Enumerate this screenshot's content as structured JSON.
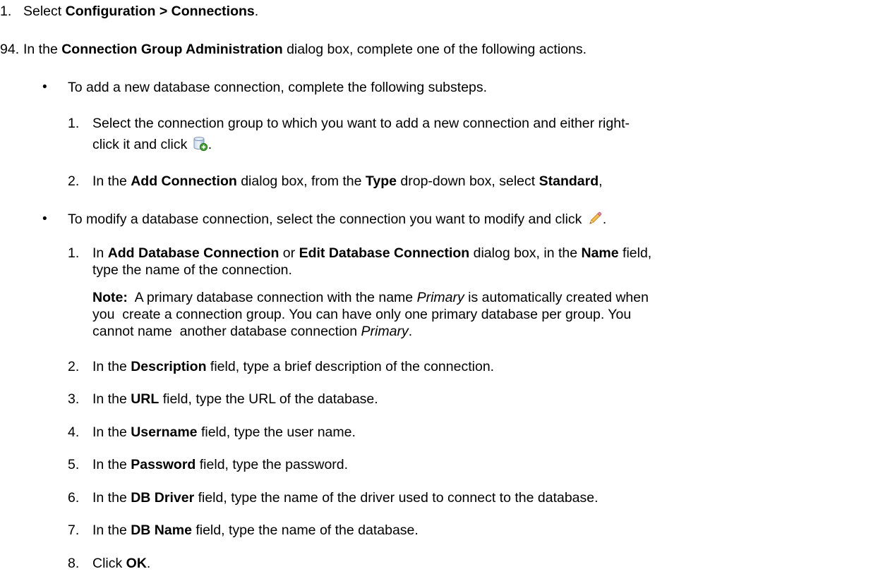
{
  "steps": [
    {
      "number": "1.",
      "parts": [
        {
          "text": "Select ",
          "bold": false
        },
        {
          "text": "Configuration > Connections",
          "bold": true
        },
        {
          "text": ".",
          "bold": false
        }
      ]
    },
    {
      "number": "94.",
      "parts": [
        {
          "text": "In the ",
          "bold": false
        },
        {
          "text": "Connection Group Administration",
          "bold": true
        },
        {
          "text": " dialog box, complete one of the following actions.",
          "bold": false
        }
      ]
    }
  ],
  "bullets": [
    {
      "text": "To add a new database connection, complete the following substeps.",
      "substeps": [
        {
          "number": "1.",
          "line1": "Select the connection group to which you want to add a new connection and either right-",
          "line2": "click it and click",
          "icon": "add-database-icon",
          "after_icon": "."
        },
        {
          "number": "2.",
          "parts": [
            {
              "text": "In the ",
              "bold": false
            },
            {
              "text": "Add Connection",
              "bold": true
            },
            {
              "text": " dialog box, from the ",
              "bold": false
            },
            {
              "text": "Type",
              "bold": true
            },
            {
              "text": " drop-down box, select ",
              "bold": false
            },
            {
              "text": "Standard",
              "bold": true
            },
            {
              "text": ",",
              "bold": false
            }
          ]
        }
      ]
    },
    {
      "text": "To modify a database connection, select the connection you want to modify and click",
      "icon": "edit-pencil-icon",
      "after_icon": ".",
      "substeps": [
        {
          "number": "1.",
          "line1_parts": [
            {
              "text": "In ",
              "bold": false
            },
            {
              "text": "Add Database Connection",
              "bold": true
            },
            {
              "text": " or ",
              "bold": false
            },
            {
              "text": "Edit Database Connection",
              "bold": true
            },
            {
              "text": " dialog box, in the ",
              "bold": false
            },
            {
              "text": "Name",
              "bold": true
            },
            {
              "text": " field,",
              "bold": false
            }
          ],
          "line2": "type the  name of the connection.",
          "note": {
            "label": "Note:",
            "line1_a": "  A primary database connection with the name ",
            "line1_italic": "Primary",
            "line1_b": " is automatically created when",
            "line2": "you  create a connection group. You can have only one primary database per group. You",
            "line3_a": "cannot name  another database connection ",
            "line3_italic": "Primary",
            "line3_b": "."
          }
        },
        {
          "number": "2.",
          "parts": [
            {
              "text": "In the ",
              "bold": false
            },
            {
              "text": "Description",
              "bold": true
            },
            {
              "text": " field, type a brief description of the connection.",
              "bold": false
            }
          ]
        },
        {
          "number": "3.",
          "parts": [
            {
              "text": "In the ",
              "bold": false
            },
            {
              "text": "URL",
              "bold": true
            },
            {
              "text": " field, type the URL of the database.",
              "bold": false
            }
          ]
        },
        {
          "number": "4.",
          "parts": [
            {
              "text": "In the ",
              "bold": false
            },
            {
              "text": "Username",
              "bold": true
            },
            {
              "text": " field, type the user name.",
              "bold": false
            }
          ]
        },
        {
          "number": "5.",
          "parts": [
            {
              "text": "In the ",
              "bold": false
            },
            {
              "text": "Password",
              "bold": true
            },
            {
              "text": " field, type the password.",
              "bold": false
            }
          ]
        },
        {
          "number": "6.",
          "parts": [
            {
              "text": "In the ",
              "bold": false
            },
            {
              "text": "DB Driver",
              "bold": true
            },
            {
              "text": " field, type the name of the driver used to connect to the database.",
              "bold": false
            }
          ]
        },
        {
          "number": "7.",
          "parts": [
            {
              "text": "In the ",
              "bold": false
            },
            {
              "text": "DB Name",
              "bold": true
            },
            {
              "text": " field, type the name of the database.",
              "bold": false
            }
          ]
        },
        {
          "number": "8.",
          "parts": [
            {
              "text": "Click ",
              "bold": false
            },
            {
              "text": "OK",
              "bold": true
            },
            {
              "text": ".",
              "bold": false
            }
          ]
        }
      ]
    }
  ],
  "colors": {
    "text": "#000000",
    "background": "#ffffff"
  }
}
